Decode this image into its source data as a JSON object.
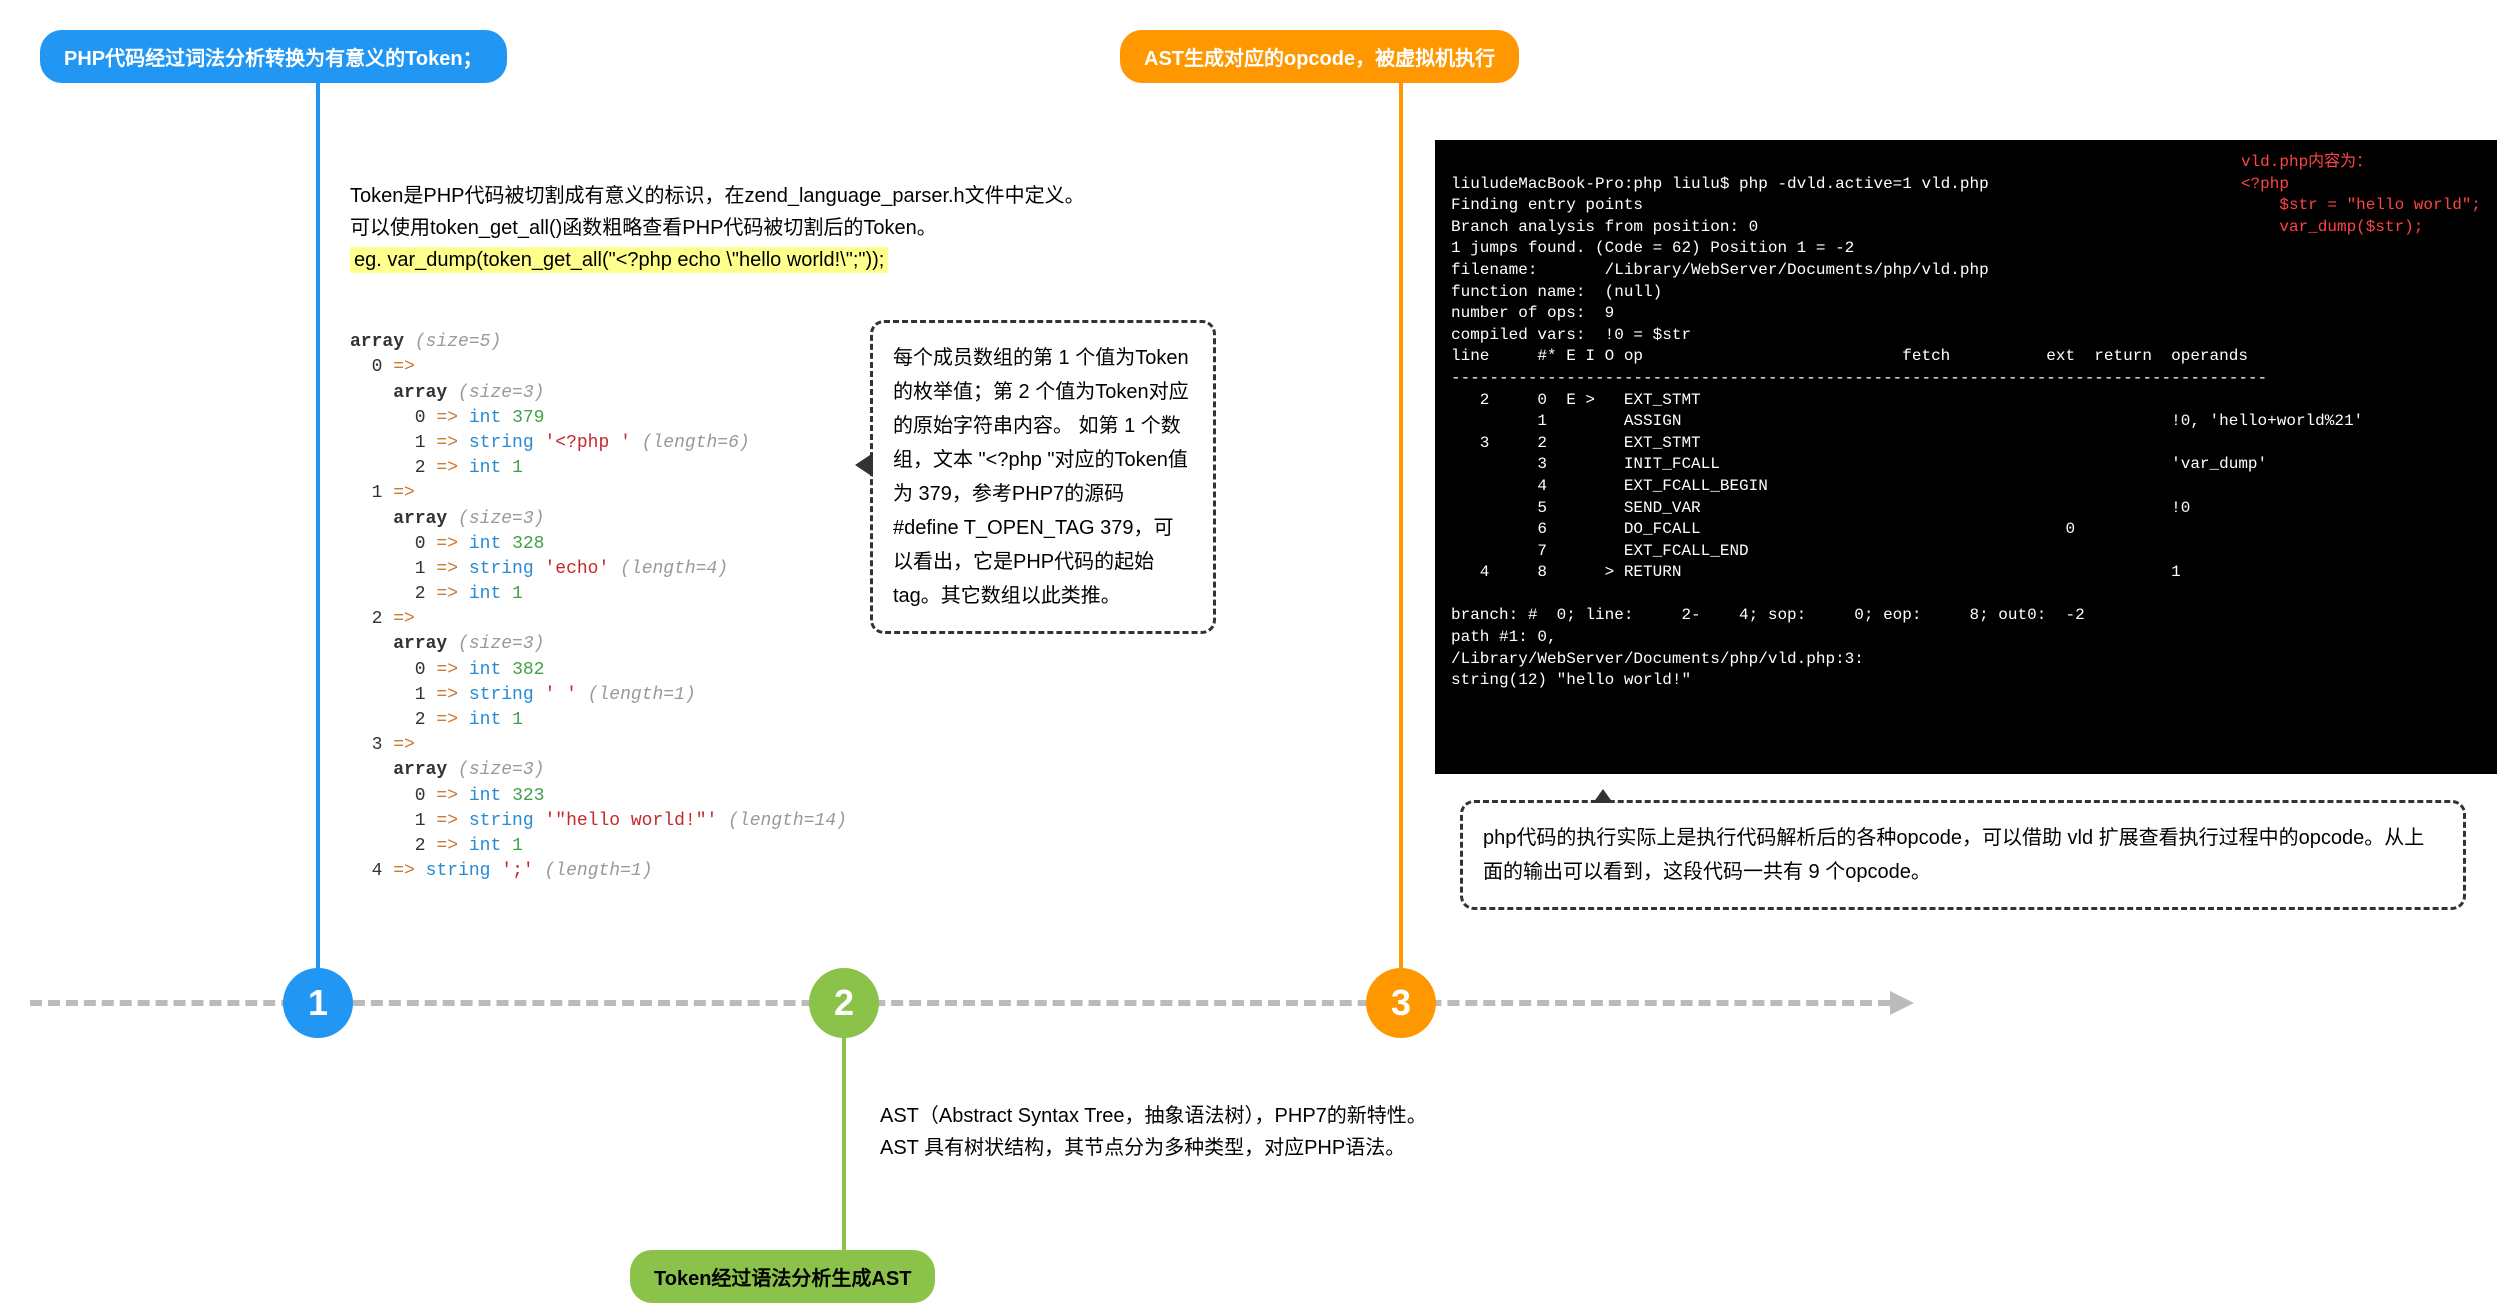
{
  "step1": {
    "bubble": "PHP代码经过词法分析转换为有意义的Token；",
    "text_line1": "Token是PHP代码被切割成有意义的标识，在zend_language_parser.h文件中定义。",
    "text_line2": "可以使用token_get_all()函数粗略查看PHP代码被切割后的Token。",
    "text_line3": "eg. var_dump(token_get_all(\"<?php echo \\\"hello world!\\\";\"));",
    "callout": "每个成员数组的第 1 个值为Token的枚举值；第 2 个值为Token对应的原始字符串内容。\n如第 1 个数组，文本 \"<?php \"对应的Token值为 379，参考PHP7的源码 #define T_OPEN_TAG 379，可以看出，它是PHP代码的起始tag。其它数组以此类推。",
    "code": "array (size=5)\n  0 =>\n    array (size=3)\n      0 => int 379\n      1 => string '<?php ' (length=6)\n      2 => int 1\n  1 =>\n    array (size=3)\n      0 => int 328\n      1 => string 'echo' (length=4)\n      2 => int 1\n  2 =>\n    array (size=3)\n      0 => int 382\n      1 => string ' ' (length=1)\n      2 => int 1\n  3 =>\n    array (size=3)\n      0 => int 323\n      1 => string '\"hello world!\"' (length=14)\n      2 => int 1\n  4 => string ';' (length=1)"
  },
  "step2": {
    "bubble": "Token经过语法分析生成AST",
    "text_line1": "AST（Abstract Syntax Tree，抽象语法树），PHP7的新特性。",
    "text_line2": "AST 具有树状结构，其节点分为多种类型，对应PHP语法。"
  },
  "step3": {
    "bubble": "AST生成对应的opcode，被虚拟机执行",
    "callout": "php代码的执行实际上是执行代码解析后的各种opcode，可以借助 vld 扩展查看执行过程中的opcode。从上面的输出可以看到，这段代码一共有 9 个opcode。",
    "terminal_header": "liuludeMacBook-Pro:php liulu$ php -dvld.active=1 vld.php\nFinding entry points\nBranch analysis from position: 0\n1 jumps found. (Code = 62) Position 1 = -2\nfilename:       /Library/WebServer/Documents/php/vld.php\nfunction name:  (null)\nnumber of ops:  9\ncompiled vars:  !0 = $str",
    "terminal_cols": "line     #* E I O op                           fetch          ext  return  operands",
    "terminal_rows": "-------------------------------------------------------------------------------------\n   2     0  E >   EXT_STMT\n         1        ASSIGN                                                   !0, 'hello+world%21'\n   3     2        EXT_STMT\n         3        INIT_FCALL                                               'var_dump'\n         4        EXT_FCALL_BEGIN\n         5        SEND_VAR                                                 !0\n         6        DO_FCALL                                      0\n         7        EXT_FCALL_END\n   4     8      > RETURN                                                   1\n",
    "terminal_footer": "branch: #  0; line:     2-    4; sop:     0; eop:     8; out0:  -2\npath #1: 0,\n/Library/WebServer/Documents/php/vld.php:3:\nstring(12) \"hello world!\"",
    "red_note": "vld.php内容为：\n<?php\n    $str = \"hello world\";\n    var_dump($str);"
  },
  "numbers": {
    "n1": "1",
    "n2": "2",
    "n3": "3"
  }
}
